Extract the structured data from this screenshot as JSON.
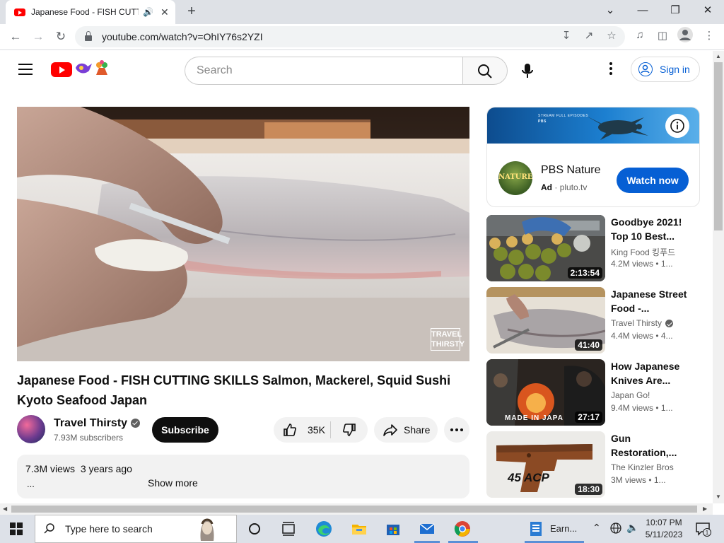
{
  "browser": {
    "tab_title": "Japanese Food - FISH CUTTING SKILLS",
    "url": "youtube.com/watch?v=OhIY76s2YZI"
  },
  "youtube": {
    "search_placeholder": "Search",
    "sign_in": "Sign in"
  },
  "video": {
    "title": "Japanese Food - FISH CUTTING SKILLS Salmon, Mackerel, Squid Sushi Kyoto Seafood Japan",
    "watermark": "TRAVEL THIRSTY",
    "channel": "Travel Thirsty",
    "subscribers": "7.93M subscribers",
    "subscribe_label": "Subscribe",
    "likes": "35K",
    "share_label": "Share",
    "views": "7.3M views",
    "age": "3 years ago",
    "desc_ellipsis": "...",
    "show_more": "Show more"
  },
  "ad": {
    "name": "PBS Nature",
    "label": "Ad",
    "separator": "·",
    "domain": "pluto.tv",
    "cta": "Watch now",
    "logo_text": "NATURE",
    "banner_line1": "STREAM FULL EPISODES",
    "banner_line2": "PBS"
  },
  "related": [
    {
      "title": "Goodbye 2021! Top 10 Best...",
      "channel": "King Food 킹푸드",
      "meta": "4.2M views  • 1...",
      "duration": "2:13:54"
    },
    {
      "title": "Japanese Street Food -...",
      "channel": "Travel Thirsty",
      "meta": "4.4M views  • 4...",
      "duration": "41:40"
    },
    {
      "title": "How Japanese Knives Are...",
      "channel": "Japan Go!",
      "meta": "9.4M views  • 1...",
      "duration": "27:17",
      "thumb_caption": "MADE IN JAPA"
    },
    {
      "title": "Gun Restoration,...",
      "channel": "The Kinzler Bros",
      "meta": "3M views  • 1...",
      "duration": "18:30",
      "thumb_caption": "45 ACP"
    }
  ],
  "taskbar": {
    "search_label": "Type here to search",
    "app_label": "Earn...",
    "time": "10:07 PM",
    "date": "5/11/2023",
    "notif_count": "1"
  },
  "colors": {
    "youtube_red": "#ff0000",
    "link_blue": "#065fd4",
    "ad_cta": "#065fd4",
    "subscribe_bg": "#0f0f0f"
  }
}
